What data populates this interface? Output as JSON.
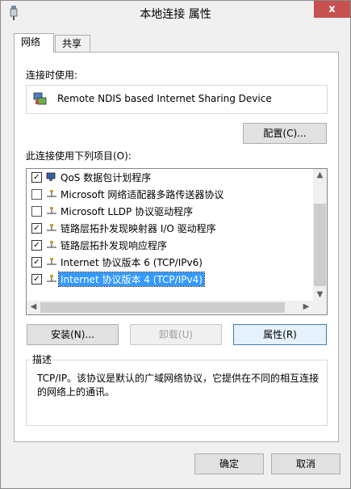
{
  "window": {
    "title": "本地连接 属性",
    "close_label": "x"
  },
  "tabs": [
    {
      "label": "网络"
    },
    {
      "label": "共享"
    }
  ],
  "connect_using": {
    "label": "连接时使用:",
    "device_name": "Remote NDIS based Internet Sharing Device",
    "configure_label": "配置(C)..."
  },
  "items_section": {
    "label": "此连接使用下列项目(O):",
    "items": [
      {
        "label": "QoS 数据包计划程序",
        "checked": true
      },
      {
        "label": "Microsoft 网络适配器多路传送器协议",
        "checked": false
      },
      {
        "label": "Microsoft LLDP 协议驱动程序",
        "checked": false
      },
      {
        "label": "链路层拓扑发现映射器 I/O 驱动程序",
        "checked": true
      },
      {
        "label": "链路层拓扑发现响应程序",
        "checked": true
      },
      {
        "label": "Internet 协议版本 6 (TCP/IPv6)",
        "checked": true
      },
      {
        "label": "Internet 协议版本 4 (TCP/IPv4)",
        "checked": true,
        "selected": true
      }
    ]
  },
  "buttons": {
    "install": "安装(N)...",
    "uninstall": "卸载(U)",
    "properties": "属性(R)"
  },
  "description": {
    "title": "描述",
    "text": "TCP/IP。该协议是默认的广域网络协议，它提供在不同的相互连接的网络上的通讯。"
  },
  "footer": {
    "ok": "确定",
    "cancel": "取消"
  },
  "colors": {
    "selection": "#3399ff",
    "close": "#c75050"
  }
}
